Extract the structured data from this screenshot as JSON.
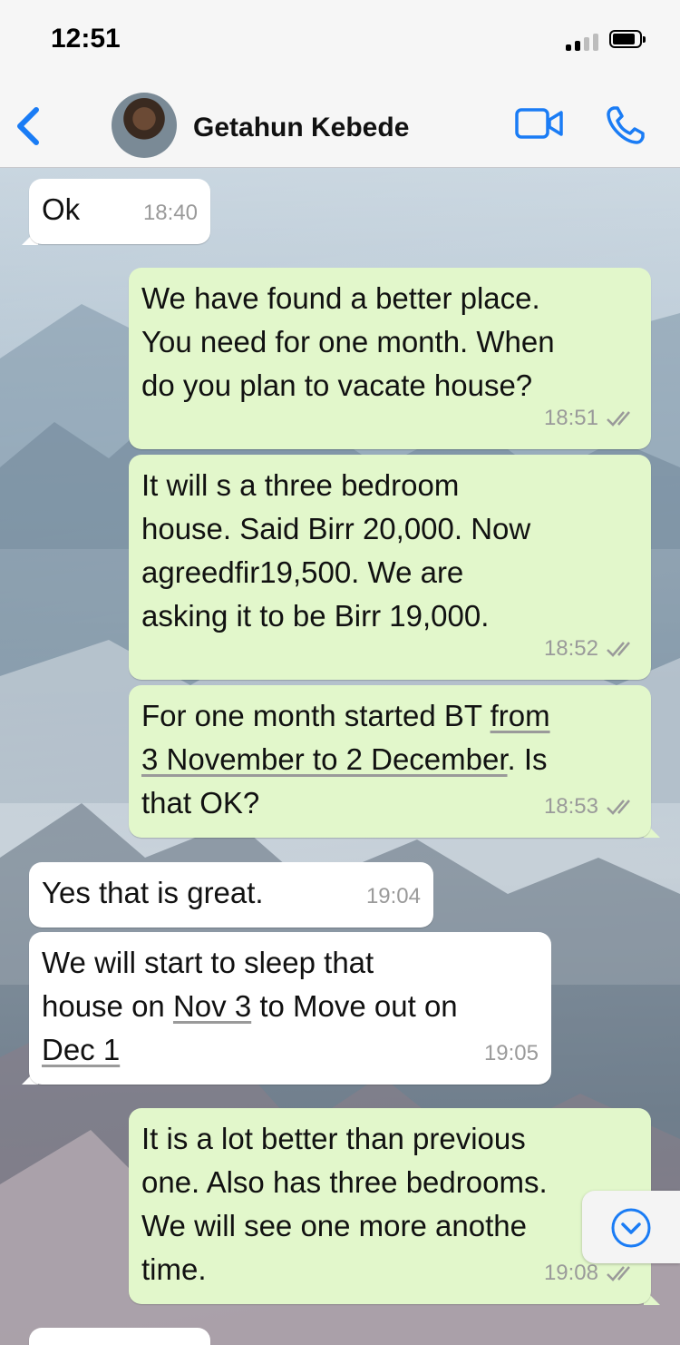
{
  "status_bar": {
    "time": "12:51"
  },
  "header": {
    "back_icon": "chevron-left-icon",
    "contact_name": "Getahun Kebede",
    "video_icon": "video-camera-icon",
    "phone_icon": "phone-icon",
    "accent_color": "#1a7cf5"
  },
  "messages": [
    {
      "direction": "in",
      "text": "Ok",
      "time": "18:40"
    },
    {
      "direction": "out",
      "lines": [
        "We have found a better place.",
        "You need for one month. When",
        "do you plan to vacate house?"
      ],
      "time": "18:51"
    },
    {
      "direction": "out",
      "lines": [
        "It will s a three bedroom",
        "house. Said Birr 20,000. Now",
        "agreedfir19,500. We are",
        "asking it to be Birr 19,000."
      ],
      "time": "18:52"
    },
    {
      "direction": "out",
      "line1_prefix": "For one month started BT ",
      "line1_link": "from",
      "line2_link": "3 November to 2 December",
      "line2_suffix": ". Is",
      "line3": "that OK?",
      "time": "18:53"
    },
    {
      "direction": "in",
      "text": "Yes that is great.",
      "time": "19:04"
    },
    {
      "direction": "in",
      "line1": "We will start to sleep that",
      "line2_prefix": "house on ",
      "line2_link": "Nov 3",
      "line2_suffix": " to Move out on",
      "line3_link": "Dec 1",
      "time": "19:05"
    },
    {
      "direction": "out",
      "lines": [
        "It is a lot better than previous",
        "one. Also has three bedrooms.",
        "We will see one more anothe",
        "time."
      ],
      "time": "19:08"
    }
  ],
  "colors": {
    "incoming_bubble": "#ffffff",
    "outgoing_bubble": "#e2f7cb",
    "read_ticks": "#9a9a9a"
  },
  "scroll_down_icon": "chevron-down-circle-icon"
}
